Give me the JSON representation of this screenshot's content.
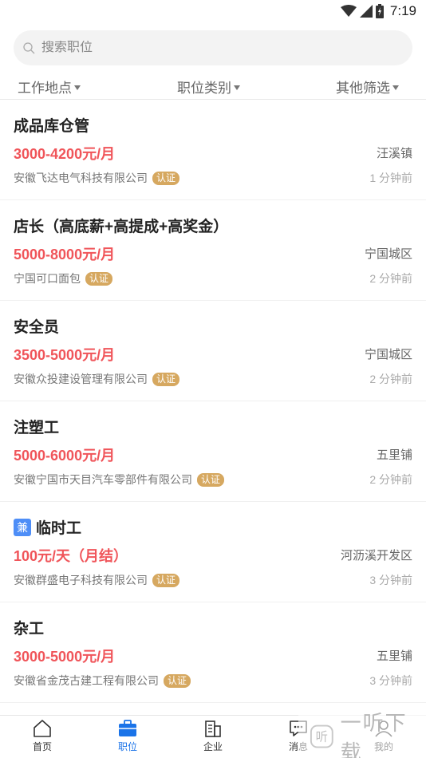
{
  "status_bar": {
    "time": "7:19"
  },
  "search": {
    "placeholder": "搜索职位"
  },
  "filters": [
    {
      "label": "工作地点"
    },
    {
      "label": "职位类别"
    },
    {
      "label": "其他筛选"
    }
  ],
  "jobs": [
    {
      "title": "成品库仓管",
      "salary": "3000-4200元/月",
      "location": "汪溪镇",
      "company": "安徽飞达电气科技有限公司",
      "badge": "认证",
      "time": "1 分钟前"
    },
    {
      "title": "店长（高底薪+高提成+高奖金）",
      "salary": "5000-8000元/月",
      "location": "宁国城区",
      "company": "宁国可口面包",
      "badge": "认证",
      "time": "2 分钟前"
    },
    {
      "title": "安全员",
      "salary": "3500-5000元/月",
      "location": "宁国城区",
      "company": "安徽众投建设管理有限公司",
      "badge": "认证",
      "time": "2 分钟前"
    },
    {
      "title": "注塑工",
      "salary": "5000-6000元/月",
      "location": "五里铺",
      "company": "安徽宁国市天目汽车零部件有限公司",
      "badge": "认证",
      "time": "2 分钟前"
    },
    {
      "title": "临时工",
      "tag": "兼",
      "salary": "100元/天（月结）",
      "location": "河沥溪开发区",
      "company": "安徽群盛电子科技有限公司",
      "badge": "认证",
      "time": "3 分钟前"
    },
    {
      "title": "杂工",
      "salary": "3000-5000元/月",
      "location": "五里铺",
      "company": "安徽省金茂古建工程有限公司",
      "badge": "认证",
      "time": "3 分钟前"
    }
  ],
  "tabbar": [
    {
      "label": "首页",
      "icon": "home-icon"
    },
    {
      "label": "职位",
      "icon": "briefcase-icon",
      "active": true
    },
    {
      "label": "企业",
      "icon": "building-icon"
    },
    {
      "label": "消息",
      "icon": "message-icon"
    },
    {
      "label": "我的",
      "icon": "person-icon"
    }
  ],
  "watermark": {
    "text": "一听下载"
  },
  "colors": {
    "salary": "#f0555a",
    "accent": "#1a73e8",
    "badge": "#d6a860",
    "tag": "#4e8ef7"
  }
}
